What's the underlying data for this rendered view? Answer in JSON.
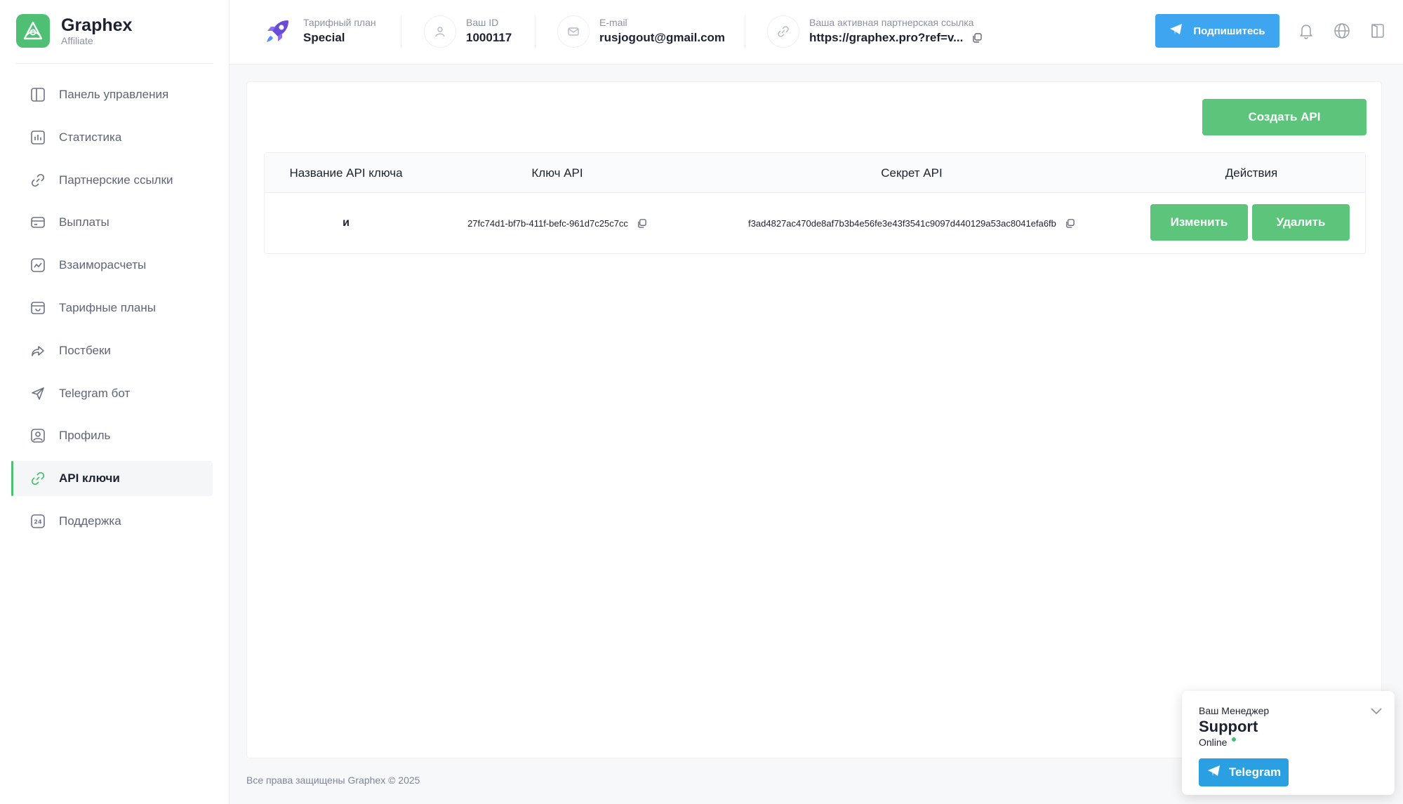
{
  "brand": {
    "name": "Graphex",
    "subtitle": "Affiliate"
  },
  "sidebar": {
    "items": [
      {
        "label": "Панель управления",
        "icon": "dashboard-icon"
      },
      {
        "label": "Статистика",
        "icon": "chart-icon"
      },
      {
        "label": "Партнерские ссылки",
        "icon": "link-icon"
      },
      {
        "label": "Выплаты",
        "icon": "card-icon"
      },
      {
        "label": "Взаиморасчеты",
        "icon": "trend-icon"
      },
      {
        "label": "Тарифные планы",
        "icon": "calendar-icon"
      },
      {
        "label": "Постбеки",
        "icon": "share-icon"
      },
      {
        "label": "Telegram бот",
        "icon": "send-icon"
      },
      {
        "label": "Профиль",
        "icon": "user-icon"
      },
      {
        "label": "API ключи",
        "icon": "link-icon",
        "active": true
      },
      {
        "label": "Поддержка",
        "icon": "support-24-icon"
      }
    ]
  },
  "header": {
    "plan_label": "Тарифный план",
    "plan_value": "Special",
    "id_label": "Ваш ID",
    "id_value": "1000117",
    "email_label": "E-mail",
    "email_value": "rusjogout@gmail.com",
    "link_label": "Ваша активная партнерская ссылка",
    "link_value": "https://graphex.pro?ref=v...",
    "subscribe_label": "Подпишитесь"
  },
  "main": {
    "create_button": "Создать API",
    "table": {
      "columns": [
        "Название API ключа",
        "Ключ API",
        "Секрет API",
        "Действия"
      ],
      "rows": [
        {
          "name": "и",
          "key": "27fc74d1-bf7b-411f-befc-961d7c25c7cc",
          "secret": "f3ad4827ac470de8af7b3b4e56fe3e43f3541c9097d440129a53ac8041efa6fb",
          "edit_label": "Изменить",
          "delete_label": "Удалить"
        }
      ]
    }
  },
  "footer": {
    "text": "Все права защищены Graphex © 2025"
  },
  "support_widget": {
    "label": "Ваш Менеджер",
    "name": "Support",
    "status": "Online",
    "button": "Telegram"
  },
  "colors": {
    "accent": "#5cc47b",
    "telegram": "#3ea6f0",
    "text": "#1c2230",
    "muted": "#8a92a3"
  }
}
